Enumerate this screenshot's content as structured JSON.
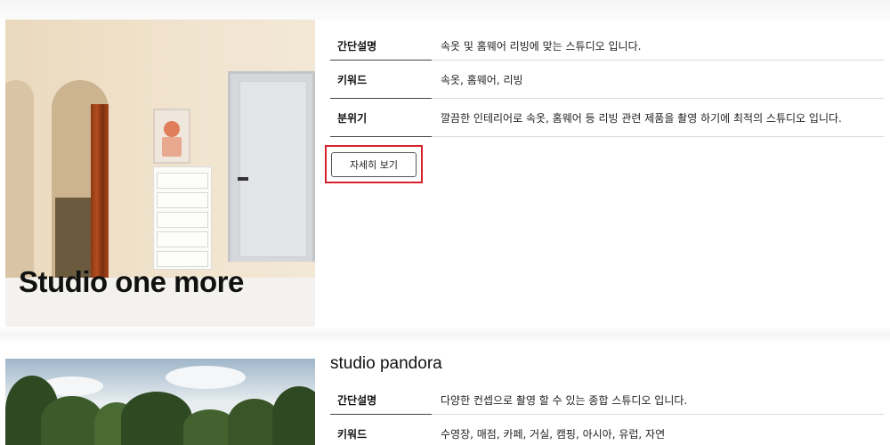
{
  "studios": [
    {
      "image_caption": "Studio one more",
      "rows": [
        {
          "label": "간단설명",
          "value": "속옷 및 홈웨어 리빙에 맞는 스튜디오 입니다."
        },
        {
          "label": "키워드",
          "value": "속옷, 홈웨어, 리빙"
        },
        {
          "label": "분위기",
          "value": "깔끔한 인테리어로 속옷, 홈웨어 등 리빙 관련 제품을 촬영 하기에 최적의 스튜디오 입니다."
        }
      ],
      "detail_button": "자세히 보기"
    },
    {
      "name": "studio pandora",
      "rows": [
        {
          "label": "간단설명",
          "value": "다양한 컨셉으로 촬영 할 수 있는 종합 스튜디오 입니다."
        },
        {
          "label": "키워드",
          "value": "수영장, 매점, 카페, 거실, 캠핑, 아시아, 유럽, 자연"
        }
      ]
    }
  ],
  "highlight_color": "#d9212b"
}
